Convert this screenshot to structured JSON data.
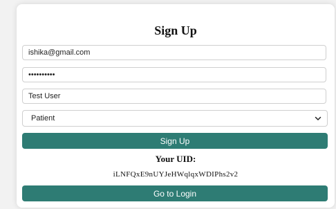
{
  "form": {
    "title": "Sign Up",
    "email_value": "ishika@gmail.com",
    "password_masked": "••••••••••",
    "name_value": "Test User",
    "role_selected": "Patient",
    "signup_label": "Sign Up"
  },
  "uid": {
    "label": "Your UID:",
    "value": "iLNFQxE9nUYJeHWqlqxWDIPhs2v2"
  },
  "login": {
    "label": "Go to Login"
  },
  "colors": {
    "button": "#2e7c74",
    "background": "#f2f2f2",
    "card": "#ffffff"
  },
  "icons": {
    "select_arrow": "chevron-down-icon"
  }
}
